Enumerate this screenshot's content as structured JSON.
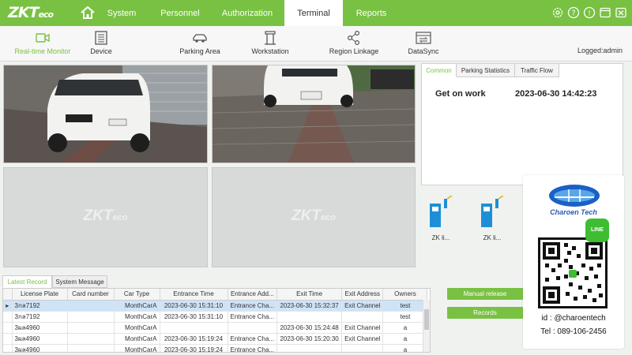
{
  "app": {
    "logo_main": "ZKT",
    "logo_sub": "eco",
    "accent_color": "#79c142"
  },
  "nav": {
    "tabs": [
      {
        "label": "System"
      },
      {
        "label": "Personnel"
      },
      {
        "label": "Authorization"
      },
      {
        "label": "Terminal",
        "active": true
      },
      {
        "label": "Reports"
      }
    ],
    "window_controls": [
      "gear-icon",
      "help-icon",
      "info-icon",
      "maximize-icon",
      "close-icon"
    ]
  },
  "toolbar": {
    "items": [
      {
        "label": "Real-time Monitor",
        "icon": "video-camera-icon",
        "active": true
      },
      {
        "label": "Device",
        "icon": "device-list-icon"
      },
      {
        "label": "Parking Area",
        "icon": "car-icon"
      },
      {
        "label": "Workstation",
        "icon": "barrier-gate-icon"
      },
      {
        "label": "Region Linkage",
        "icon": "share-icon"
      },
      {
        "label": "DataSync",
        "icon": "datasync-icon"
      }
    ],
    "logged_in": "Logged:admin"
  },
  "cameras": [
    {
      "state": "live"
    },
    {
      "state": "live"
    },
    {
      "state": "empty",
      "watermark": "ZKT",
      "watermark_sub": "eco"
    },
    {
      "state": "empty",
      "watermark": "ZKT",
      "watermark_sub": "eco"
    }
  ],
  "right_panel": {
    "tabs": [
      {
        "label": "Common",
        "active": true
      },
      {
        "label": "Parking Statistics"
      },
      {
        "label": "Traffic Flow"
      }
    ],
    "event_label": "Get on work",
    "event_time": "2023-06-30 14:42:23"
  },
  "devices": [
    {
      "label": "ZK li..."
    },
    {
      "label": "ZK li..."
    }
  ],
  "bottom_tabs": [
    {
      "label": "Latest Record",
      "active": true
    },
    {
      "label": "System Message"
    }
  ],
  "records": {
    "columns": [
      "License Plate",
      "Card number",
      "Car Type",
      "Entrance Time",
      "Entrance Add...",
      "Exit Time",
      "Exit Address",
      "Owners"
    ],
    "rows": [
      [
        "3กล7192",
        "",
        "MonthCarA",
        "2023-06-30 15:31:10",
        "Entrance Cha...",
        "2023-06-30 15:32:37",
        "Exit Channel",
        "test"
      ],
      [
        "3กล7192",
        "",
        "MonthCarA",
        "2023-06-30 15:31:10",
        "Entrance Cha...",
        "",
        "",
        "test"
      ],
      [
        "3ผล4960",
        "",
        "MonthCarA",
        "",
        "",
        "2023-06-30 15:24:48",
        "Exit Channel",
        "a"
      ],
      [
        "3ผล4960",
        "",
        "MonthCarA",
        "2023-06-30 15:19:24",
        "Entrance Cha...",
        "2023-06-30 15:20:30",
        "Exit Channel",
        "a"
      ],
      [
        "3ผล4960",
        "",
        "MonthCarA",
        "2023-06-30 15:19:24",
        "Entrance Cha...",
        "",
        "",
        "a"
      ]
    ]
  },
  "actions": {
    "manual_release": "Manual release",
    "records": "Records"
  },
  "overlay": {
    "logo_text": "Charoen Tech",
    "line_badge": "LINE",
    "id_text": "id : @charoentech",
    "tel_text": "Tel : 089-106-2456"
  }
}
